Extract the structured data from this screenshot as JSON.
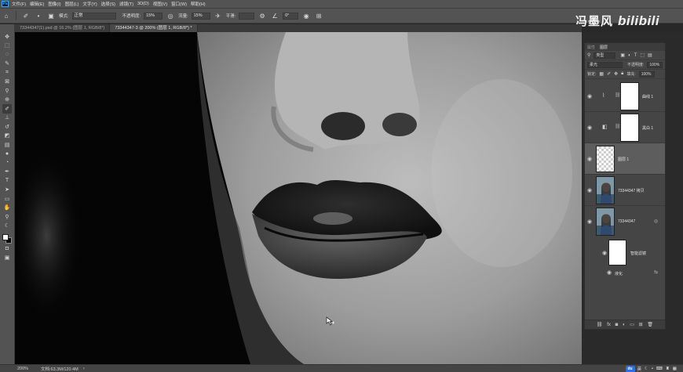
{
  "app": {
    "logo": "Ps"
  },
  "menu": [
    "文件(F)",
    "编辑(E)",
    "图像(I)",
    "图层(L)",
    "文字(Y)",
    "选择(S)",
    "滤镜(T)",
    "3D(D)",
    "视图(V)",
    "窗口(W)",
    "帮助(H)"
  ],
  "options": {
    "mode_label": "模式:",
    "mode_value": "正常",
    "opacity_label": "不透明度:",
    "opacity_value": "15%",
    "flow_label": "流量:",
    "flow_value": "15%",
    "smoothing_label": "平滑:",
    "smoothing_value": "",
    "angle_value": "0°"
  },
  "watermark": {
    "text": "冯墨风",
    "logo": "bilibili"
  },
  "tabs": [
    {
      "label": "73344347(1).psd @ 16.2% (图层 1, RGB/8*)",
      "active": false
    },
    {
      "label": "73344347-3 @ 200% (图层 1, RGB/8*) *",
      "active": true
    }
  ],
  "tools": [
    {
      "icon": "move-icon",
      "glyph": "✥"
    },
    {
      "icon": "marquee-icon",
      "glyph": "⬚"
    },
    {
      "icon": "lasso-icon",
      "glyph": "◌"
    },
    {
      "icon": "quick-select-icon",
      "glyph": "✎"
    },
    {
      "icon": "crop-icon",
      "glyph": "⌗"
    },
    {
      "icon": "frame-icon",
      "glyph": "⊠"
    },
    {
      "icon": "eyedropper-icon",
      "glyph": "⚲"
    },
    {
      "icon": "healing-brush-icon",
      "glyph": "⊕"
    },
    {
      "icon": "brush-icon",
      "glyph": "✐",
      "active": true
    },
    {
      "icon": "stamp-icon",
      "glyph": "⊥"
    },
    {
      "icon": "history-brush-icon",
      "glyph": "↺"
    },
    {
      "icon": "eraser-icon",
      "glyph": "◩"
    },
    {
      "icon": "gradient-icon",
      "glyph": "▤"
    },
    {
      "icon": "blur-icon",
      "glyph": "●"
    },
    {
      "icon": "dodge-icon",
      "glyph": "◔"
    },
    {
      "icon": "pen-icon",
      "glyph": "✒"
    },
    {
      "icon": "type-icon",
      "glyph": "T"
    },
    {
      "icon": "path-select-icon",
      "glyph": "➤"
    },
    {
      "icon": "rectangle-icon",
      "glyph": "▭"
    },
    {
      "icon": "hand-icon",
      "glyph": "✋"
    },
    {
      "icon": "zoom-icon",
      "glyph": "⚲"
    },
    {
      "icon": "banana-icon",
      "glyph": "☾"
    }
  ],
  "layers_panel": {
    "tabs": [
      "属性",
      "图层"
    ],
    "kind_label": "类型",
    "blend_mode": "柔光",
    "opacity_label": "不透明度:",
    "opacity_value": "100%",
    "lock_label": "锁定:",
    "fill_label": "填充:",
    "fill_value": "100%",
    "layers": [
      {
        "name": "曲线 1",
        "type": "curves"
      },
      {
        "name": "黑白 1",
        "type": "black-white"
      },
      {
        "name": "图层 1",
        "type": "pixel",
        "selected": true
      },
      {
        "name": "73344347 拷贝",
        "type": "photo"
      },
      {
        "name": "73344347",
        "type": "smart-object"
      }
    ],
    "smart_filters": "智能滤镜",
    "filter_name": "液化"
  },
  "status": {
    "zoom": "200%",
    "doc_size": "文档:63.3M/120.4M",
    "ime_label": "英",
    "ime_logo": "du"
  },
  "colors": {
    "accent": "#31a8ff",
    "panel_bg": "#454545",
    "selected_layer": "#5d5d5d"
  }
}
